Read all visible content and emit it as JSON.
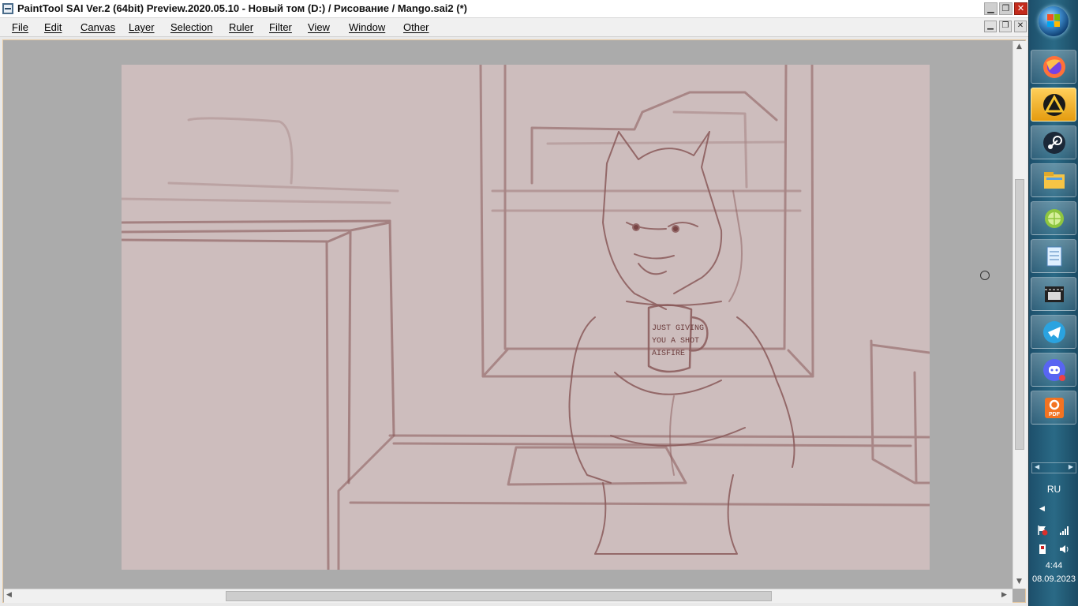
{
  "window": {
    "title": "PaintTool SAI Ver.2 (64bit) Preview.2020.05.10 - Новый том (D:) / Рисование / Mango.sai2 (*)",
    "controls": {
      "minimize": "▁",
      "restore": "❐",
      "close": "✕"
    }
  },
  "menu": {
    "items": [
      "File",
      "Edit",
      "Canvas",
      "Layer",
      "Selection",
      "Ruler",
      "Filter",
      "View",
      "Window",
      "Other"
    ]
  },
  "canvas": {
    "background_color": "#cdbdbd",
    "workspace_color": "#ababab",
    "sketch_color": "#8a5a5a",
    "mug_text": [
      "JUST GIVING",
      "YOU A SHOT",
      "AISFIRE"
    ]
  },
  "scrollbars": {
    "vertical_position": 0.25,
    "horizontal_position": 0.22
  },
  "taskbar": {
    "apps": [
      {
        "name": "firefox-icon",
        "active": false
      },
      {
        "name": "arma-launcher-icon",
        "active": true
      },
      {
        "name": "steam-icon",
        "active": false
      },
      {
        "name": "file-explorer-icon",
        "active": false
      },
      {
        "name": "lime-app-icon",
        "active": false
      },
      {
        "name": "notepad-icon",
        "active": false
      },
      {
        "name": "media-player-classic-icon",
        "active": false
      },
      {
        "name": "telegram-icon",
        "active": false
      },
      {
        "name": "discord-icon",
        "active": false
      },
      {
        "name": "foxit-pdf-icon",
        "active": false
      }
    ],
    "pdf_label": "PDF",
    "language": "RU",
    "time": "4:44",
    "date": "08.09.2023"
  }
}
